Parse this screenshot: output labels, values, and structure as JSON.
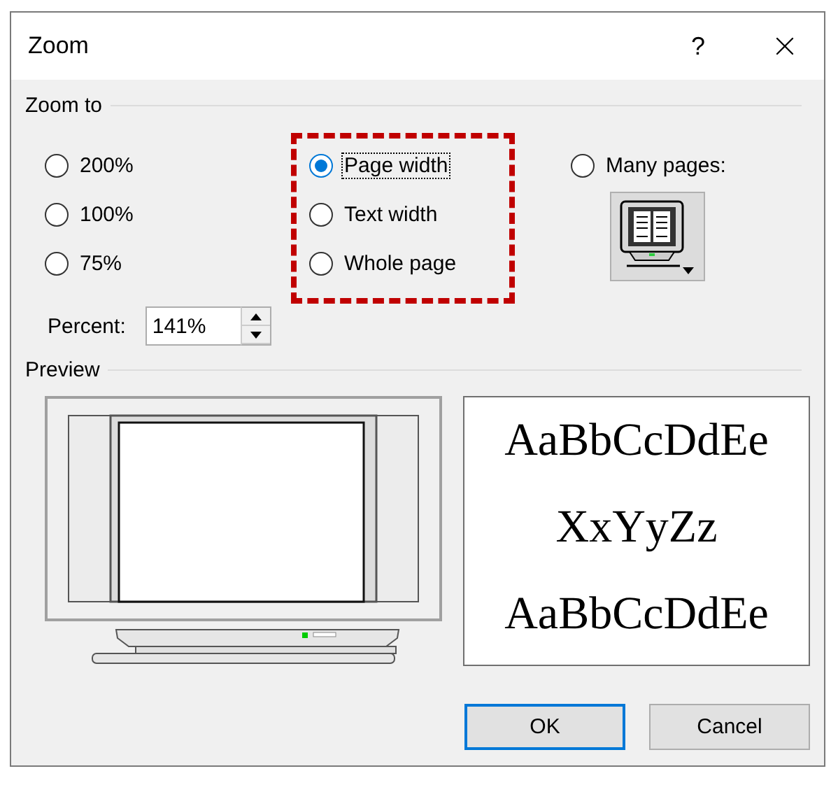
{
  "window": {
    "title": "Zoom",
    "help": "?"
  },
  "zoom_to": {
    "label": "Zoom to",
    "fixed_options": [
      {
        "label": "200%",
        "selected": false,
        "focused": false
      },
      {
        "label": "100%",
        "selected": false,
        "focused": false
      },
      {
        "label": "75%",
        "selected": false,
        "focused": false
      }
    ],
    "fit_group": {
      "highlighted": true,
      "options": [
        {
          "label": "Page width",
          "selected": true,
          "focused": true
        },
        {
          "label": "Text width",
          "selected": false,
          "focused": false
        },
        {
          "label": "Whole page",
          "selected": false,
          "focused": false
        }
      ]
    },
    "many_pages": {
      "label": "Many pages:",
      "selected": false,
      "focused": false
    },
    "percent": {
      "label": "Percent:",
      "value": "141%"
    }
  },
  "preview": {
    "label": "Preview",
    "sample_lines": [
      "AaBbCcDdEe",
      "XxYyZz",
      "AaBbCcDdEe"
    ]
  },
  "buttons": [
    {
      "label": "OK",
      "default": true
    },
    {
      "label": "Cancel",
      "default": false
    }
  ]
}
